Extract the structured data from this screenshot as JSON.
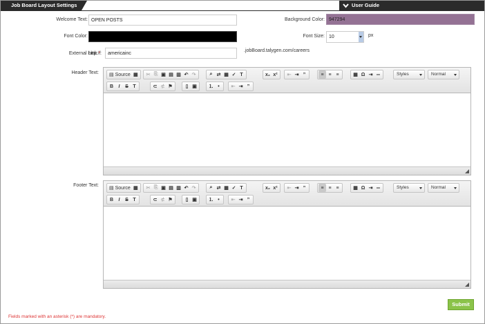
{
  "header": {
    "title": "Job Board Layout Settings",
    "guide_label": "User Guide"
  },
  "form": {
    "welcome_label": "Welcome Text:",
    "welcome_value": "OPEN POSTS",
    "bg_label": "Background Color:",
    "bg_value": "947294",
    "bg_color": "#947294",
    "font_color_label": "Font Color:",
    "font_color_value": "#000000",
    "font_size_label": "Font Size:",
    "font_size_value": "10",
    "font_size_unit": "px",
    "external_label": "External Link ",
    "external_req": "*",
    "external_colon": ":",
    "external_prefix": "http://",
    "external_value": "americainc",
    "external_suffix": ".jobBoard.talygen.com/careers",
    "header_label": "Header Text:",
    "footer_label": "Footer Text:"
  },
  "editor": {
    "source_label": "Source",
    "styles_label": "Styles",
    "format_label": "Normal"
  },
  "footer": {
    "mandatory_note": "Fields marked with an asterisk (*) are mandatory.",
    "submit_label": "Submit"
  },
  "colors": {
    "accent_green": "#8bc34a",
    "dark_bar": "#2b2b2b",
    "required": "#dd3333"
  }
}
